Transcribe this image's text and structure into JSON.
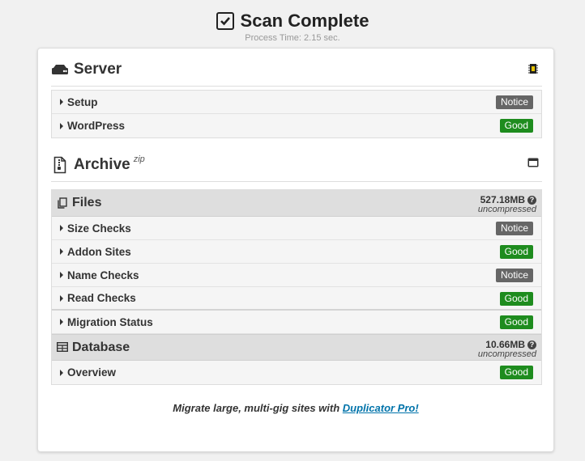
{
  "header": {
    "title": "Scan Complete",
    "process_time": "Process Time: 2.15 sec."
  },
  "server": {
    "title": "Server",
    "icon": "server-icon",
    "right_icon": "memory-chip-icon",
    "rows": [
      {
        "label": "Setup",
        "status": "Notice"
      },
      {
        "label": "WordPress",
        "status": "Good"
      }
    ]
  },
  "archive": {
    "title": "Archive",
    "superscript": "zip",
    "icon": "zip-file-icon",
    "right_icon": "window-icon",
    "files": {
      "title": "Files",
      "size": "527.18MB",
      "size_note": "uncompressed",
      "help": "?",
      "rows": [
        {
          "label": "Size Checks",
          "status": "Notice"
        },
        {
          "label": "Addon Sites",
          "status": "Good"
        },
        {
          "label": "Name Checks",
          "status": "Notice"
        },
        {
          "label": "Read Checks",
          "status": "Good"
        }
      ]
    },
    "migration": {
      "label": "Migration Status",
      "status": "Good"
    },
    "database": {
      "title": "Database",
      "size": "10.66MB",
      "size_note": "uncompressed",
      "help": "?",
      "rows": [
        {
          "label": "Overview",
          "status": "Good"
        }
      ]
    }
  },
  "promo": {
    "text": "Migrate large, multi-gig sites with ",
    "link": "Duplicator Pro!"
  },
  "colors": {
    "good": "#1e8c1e",
    "notice": "#666666",
    "link": "#0073aa"
  }
}
